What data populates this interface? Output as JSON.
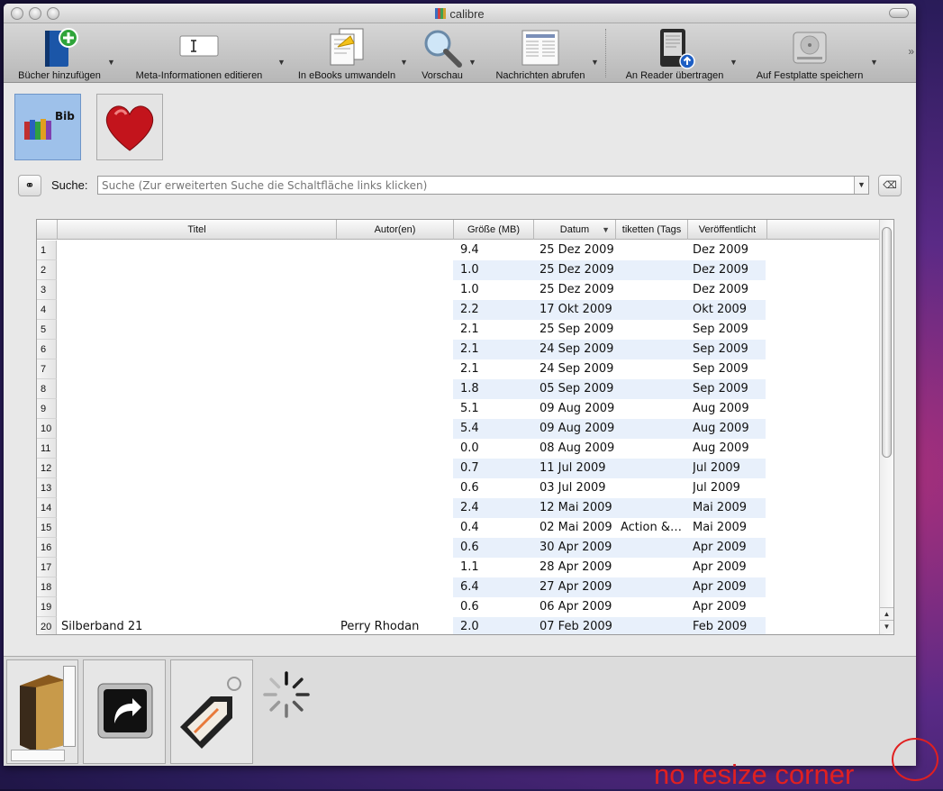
{
  "window": {
    "title": "calibre"
  },
  "toolbar": {
    "items": [
      {
        "label": "Bücher hinzufügen",
        "icon": "add-book-icon"
      },
      {
        "label": "Meta-Informationen editieren",
        "icon": "edit-metadata-icon"
      },
      {
        "label": "In eBooks umwandeln",
        "icon": "convert-icon"
      },
      {
        "label": "Vorschau",
        "icon": "magnifier-icon"
      },
      {
        "label": "Nachrichten abrufen",
        "icon": "news-icon"
      },
      {
        "label": "An Reader übertragen",
        "icon": "reader-device-icon"
      },
      {
        "label": "Auf Festplatte speichern",
        "icon": "harddisk-icon"
      }
    ],
    "more": "»"
  },
  "library": {
    "buttons": [
      {
        "name": "library-icon",
        "text": "Bib"
      },
      {
        "name": "heart-icon",
        "text": ""
      }
    ]
  },
  "search": {
    "label": "Suche:",
    "placeholder": "Suche (Zur erweiterten Suche die Schaltfläche links klicken)",
    "dropdown": "▼",
    "clear": "⌫"
  },
  "table": {
    "columns": [
      "Titel",
      "Autor(en)",
      "Größe (MB)",
      "Datum",
      "tiketten (Tags",
      "Veröffentlicht"
    ],
    "sort_indicator": "▼",
    "rows": [
      {
        "n": "1",
        "title": "",
        "author": "",
        "size": "9.4",
        "date": "25 Dez 2009",
        "tags": "",
        "pub": "Dez 2009"
      },
      {
        "n": "2",
        "title": "",
        "author": "",
        "size": "1.0",
        "date": "25 Dez 2009",
        "tags": "",
        "pub": "Dez 2009"
      },
      {
        "n": "3",
        "title": "",
        "author": "",
        "size": "1.0",
        "date": "25 Dez 2009",
        "tags": "",
        "pub": "Dez 2009"
      },
      {
        "n": "4",
        "title": "",
        "author": "",
        "size": "2.2",
        "date": "17 Okt 2009",
        "tags": "",
        "pub": "Okt 2009"
      },
      {
        "n": "5",
        "title": "",
        "author": "",
        "size": "2.1",
        "date": "25 Sep 2009",
        "tags": "",
        "pub": "Sep 2009"
      },
      {
        "n": "6",
        "title": "",
        "author": "",
        "size": "2.1",
        "date": "24 Sep 2009",
        "tags": "",
        "pub": "Sep 2009"
      },
      {
        "n": "7",
        "title": "",
        "author": "",
        "size": "2.1",
        "date": "24 Sep 2009",
        "tags": "",
        "pub": "Sep 2009"
      },
      {
        "n": "8",
        "title": "",
        "author": "",
        "size": "1.8",
        "date": "05 Sep 2009",
        "tags": "",
        "pub": "Sep 2009"
      },
      {
        "n": "9",
        "title": "",
        "author": "",
        "size": "5.1",
        "date": "09 Aug 2009",
        "tags": "",
        "pub": "Aug 2009"
      },
      {
        "n": "10",
        "title": "",
        "author": "",
        "size": "5.4",
        "date": "09 Aug 2009",
        "tags": "",
        "pub": "Aug 2009"
      },
      {
        "n": "11",
        "title": "",
        "author": "",
        "size": "0.0",
        "date": "08 Aug 2009",
        "tags": "",
        "pub": "Aug 2009"
      },
      {
        "n": "12",
        "title": "",
        "author": "",
        "size": "0.7",
        "date": "11 Jul 2009",
        "tags": "",
        "pub": "Jul 2009"
      },
      {
        "n": "13",
        "title": "",
        "author": "",
        "size": "0.6",
        "date": "03 Jul 2009",
        "tags": "",
        "pub": "Jul 2009"
      },
      {
        "n": "14",
        "title": "",
        "author": "",
        "size": "2.4",
        "date": "12 Mai 2009",
        "tags": "",
        "pub": "Mai 2009"
      },
      {
        "n": "15",
        "title": "",
        "author": "",
        "size": "0.4",
        "date": "02 Mai 2009",
        "tags": "Action &…",
        "pub": "Mai 2009"
      },
      {
        "n": "16",
        "title": "",
        "author": "",
        "size": "0.6",
        "date": "30 Apr 2009",
        "tags": "",
        "pub": "Apr 2009"
      },
      {
        "n": "17",
        "title": "",
        "author": "",
        "size": "1.1",
        "date": "28 Apr 2009",
        "tags": "",
        "pub": "Apr 2009"
      },
      {
        "n": "18",
        "title": "",
        "author": "",
        "size": "6.4",
        "date": "27 Apr 2009",
        "tags": "",
        "pub": "Apr 2009"
      },
      {
        "n": "19",
        "title": "",
        "author": "",
        "size": "0.6",
        "date": "06 Apr 2009",
        "tags": "",
        "pub": "Apr 2009"
      },
      {
        "n": "20",
        "title": "Silberband 21",
        "author": "Perry Rhodan",
        "size": "2.0",
        "date": "07 Feb 2009",
        "tags": "",
        "pub": "Feb 2009"
      }
    ]
  },
  "annotation": {
    "text": "no resize corner"
  }
}
